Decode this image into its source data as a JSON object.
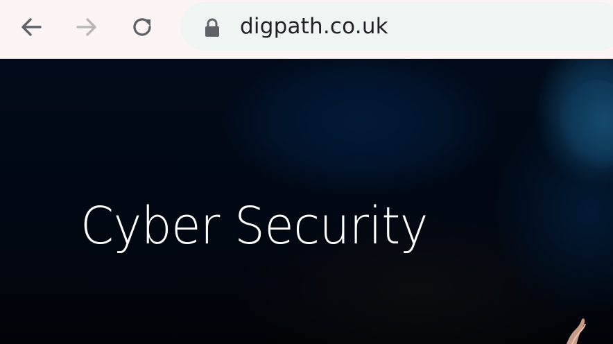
{
  "browser": {
    "url": "digpath.co.uk",
    "icons": {
      "back": "arrow-left-icon",
      "forward": "arrow-right-icon",
      "reload": "reload-icon",
      "security": "lock-icon"
    },
    "colors": {
      "toolbar": "#fdf5f5",
      "omnibox": "#eef5f3",
      "icon_active": "#5f6368",
      "icon_disabled": "#b8b8b8"
    }
  },
  "hero": {
    "title": "Cyber Security",
    "colors": {
      "background": "#010a18",
      "title": "#ffffff"
    }
  }
}
